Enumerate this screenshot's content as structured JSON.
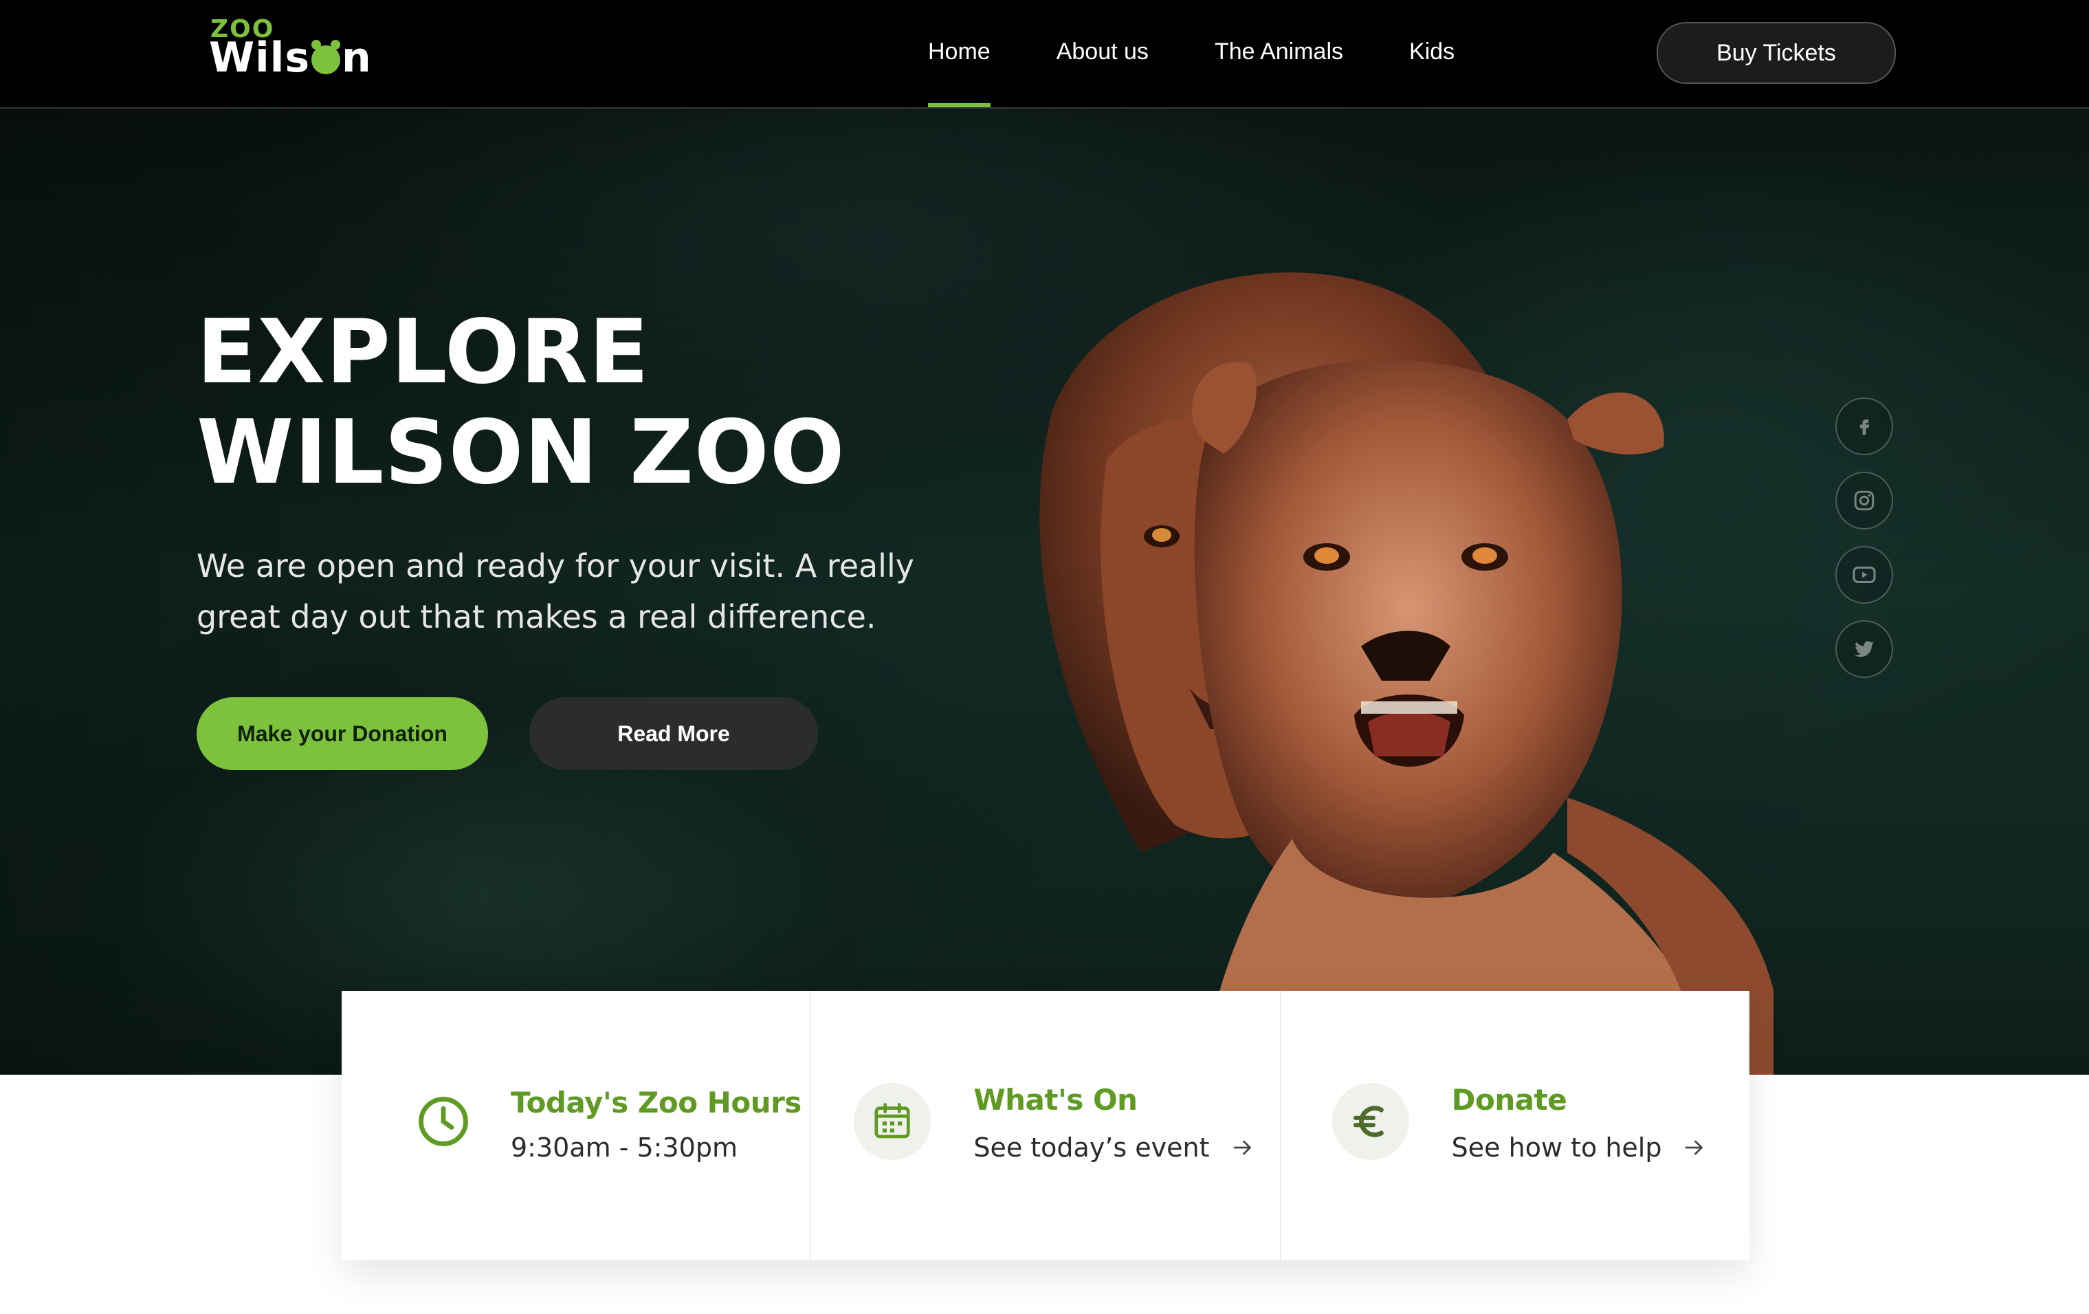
{
  "brand": {
    "logo_top": "ZOO",
    "logo_main_a": "Wils",
    "logo_main_b": "n"
  },
  "nav": {
    "items": [
      {
        "label": "Home",
        "active": true
      },
      {
        "label": "About us"
      },
      {
        "label": "The Animals"
      },
      {
        "label": "Kids"
      }
    ],
    "cta": "Buy Tickets"
  },
  "hero": {
    "title_line1": "EXPLORE",
    "title_line2": "WILSON ZOO",
    "subtitle": "We are open and ready for your visit. A really great day out that makes a real difference.",
    "primary_button": "Make your Donation",
    "secondary_button": "Read More"
  },
  "social": [
    "facebook-icon",
    "instagram-icon",
    "youtube-icon",
    "twitter-icon"
  ],
  "cards": [
    {
      "icon": "clock-icon",
      "title": "Today's Zoo Hours",
      "text": "9:30am - 5:30pm"
    },
    {
      "icon": "calendar-icon",
      "title": "What's On",
      "text": "See today’s event"
    },
    {
      "icon": "euro-icon",
      "title": "Donate",
      "text": "See how to help"
    }
  ],
  "colors": {
    "accent": "#7dc23c",
    "accent_dark": "#5f9a22",
    "nav_bg": "#000000",
    "dark_button": "#2a2d2b"
  }
}
